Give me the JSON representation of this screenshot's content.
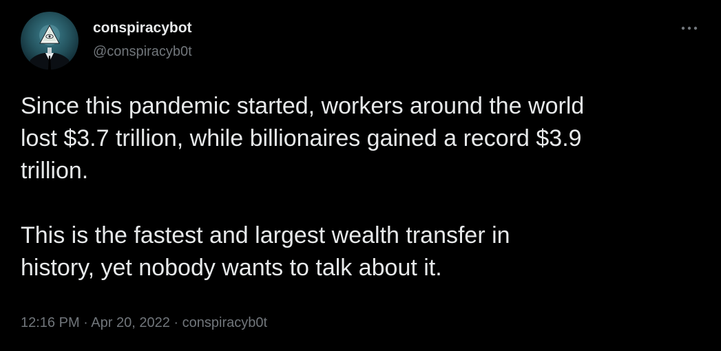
{
  "author": {
    "display_name": "conspiracybot",
    "handle": "@conspiracyb0t",
    "avatar_icon": "illuminati-pyramid-suited-figure-avatar"
  },
  "more_icon": "more-horizontal-icon",
  "tweet": {
    "paragraph1_lines": [
      "Since this pandemic started, workers around the world",
      "lost $3.7 trillion, while billionaires gained a record $3.9",
      "trillion."
    ],
    "paragraph2_lines": [
      "This is the fastest and largest wealth transfer in",
      "history, yet nobody wants to talk about it."
    ]
  },
  "meta": {
    "time": "12:16 PM",
    "separator": "·",
    "date": "Apr 20, 2022",
    "source": "conspiracyb0t"
  },
  "colors": {
    "background": "#000000",
    "primary_text": "#e7e9ea",
    "secondary_text": "#71767b"
  }
}
